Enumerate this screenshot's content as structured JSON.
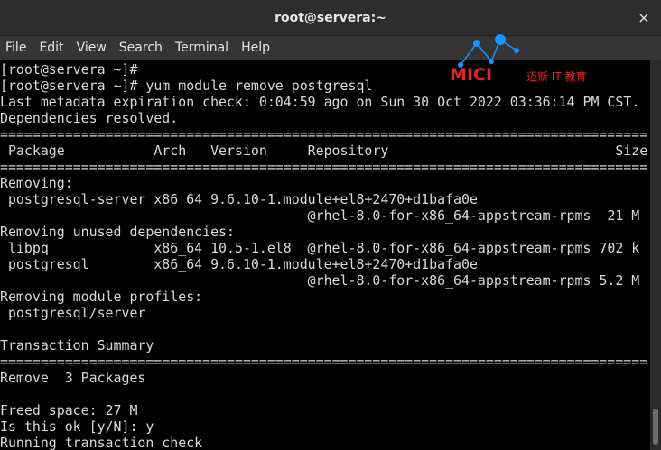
{
  "window": {
    "title": "root@servera:~",
    "close_glyph": "×"
  },
  "menu": [
    "File",
    "Edit",
    "View",
    "Search",
    "Terminal",
    "Help"
  ],
  "watermark": {
    "brand": "MICI",
    "sub": "迈斯 IT 教育",
    "color": "#e0242c",
    "node_color": "#1e90ff"
  },
  "terminal_lines": [
    "[root@servera ~]#",
    "[root@servera ~]# yum module remove postgresql",
    "Last metadata expiration check: 0:04:59 ago on Sun 30 Oct 2022 03:36:14 PM CST.",
    "Dependencies resolved.",
    "================================================================================",
    " Package           Arch   Version     Repository                            Size",
    "================================================================================",
    "Removing:",
    " postgresql-server x86_64 9.6.10-1.module+el8+2470+d1bafa0e",
    "                                      @rhel-8.0-for-x86_64-appstream-rpms  21 M",
    "Removing unused dependencies:",
    " libpq             x86_64 10.5-1.el8  @rhel-8.0-for-x86_64-appstream-rpms 702 k",
    " postgresql        x86_64 9.6.10-1.module+el8+2470+d1bafa0e",
    "                                      @rhel-8.0-for-x86_64-appstream-rpms 5.2 M",
    "Removing module profiles:",
    " postgresql/server",
    "",
    "Transaction Summary",
    "================================================================================",
    "Remove  3 Packages",
    "",
    "Freed space: 27 M",
    "Is this ok [y/N]: y",
    "Running transaction check"
  ]
}
